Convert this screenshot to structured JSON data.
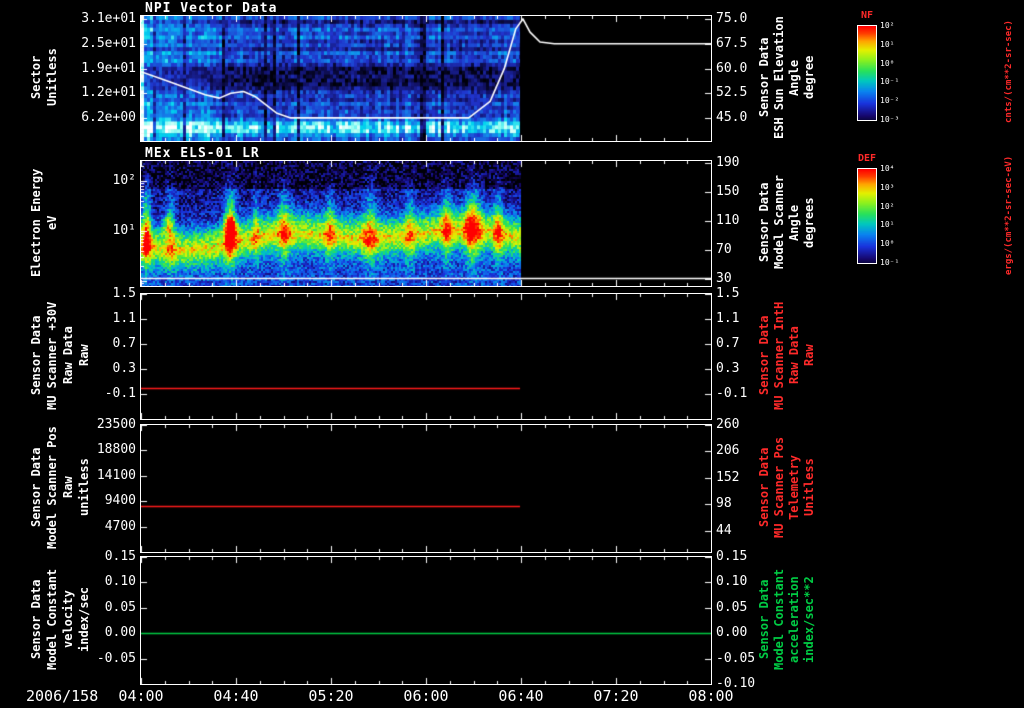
{
  "figure": {
    "date_label": "2006/158",
    "x_axis": {
      "tick_labels": [
        "04:00",
        "04:40",
        "05:20",
        "06:00",
        "06:40",
        "07:20",
        "08:00"
      ],
      "start_hour": 4.0,
      "end_hour": 8.0,
      "data_end_frac": 0.665
    }
  },
  "colors": {
    "background": "#000000",
    "axis": "#ffffff",
    "red": "#ff1a1a",
    "green": "#00cc44",
    "annotation_red": "#ff2a2a",
    "annotation_green": "#00cc44",
    "colorbar_title": "#ff2a2a"
  },
  "panels": [
    {
      "id": "npi",
      "title": "NPI Vector Data",
      "type": "spectrogram",
      "left_axis": {
        "label_lines": [
          "Sector",
          "Unitless"
        ],
        "ticks": [
          "3.1e+01",
          "2.5e+01",
          "1.9e+01",
          "1.2e+01",
          "6.2e+00"
        ],
        "tick_fracs": [
          0.024,
          0.222,
          0.42,
          0.618,
          0.816
        ],
        "color": "#ffffff"
      },
      "right_axis": {
        "label_lines": [
          "Sensor Data",
          "ESH Sun Elevation",
          "Angle",
          "degree"
        ],
        "ticks": [
          "75.0",
          "67.5",
          "60.0",
          "52.5",
          "45.0"
        ],
        "tick_fracs": [
          0.024,
          0.222,
          0.42,
          0.618,
          0.816
        ],
        "color": "#ffffff"
      },
      "overlay": {
        "name": "ESH Sun Elevation Angle",
        "color": "#ffffff",
        "value_top": 75.9,
        "value_bottom": 38.0,
        "points": [
          [
            4.0,
            59
          ],
          [
            4.2,
            56
          ],
          [
            4.45,
            52
          ],
          [
            4.55,
            51
          ],
          [
            4.63,
            52.5
          ],
          [
            4.72,
            53
          ],
          [
            4.8,
            51.5
          ],
          [
            4.95,
            46.5
          ],
          [
            5.05,
            45
          ],
          [
            6.3,
            45
          ],
          [
            6.45,
            50
          ],
          [
            6.55,
            60
          ],
          [
            6.63,
            72
          ],
          [
            6.68,
            75
          ],
          [
            6.73,
            71
          ],
          [
            6.8,
            68
          ],
          [
            6.9,
            67.5
          ],
          [
            8.0,
            67.5
          ]
        ]
      },
      "spectro": {
        "row_profile": [
          0.4,
          0.2,
          0.32,
          0.44,
          0.34,
          0.46,
          0.3,
          0.4,
          0.24,
          0.44,
          0.34,
          0.4,
          0.26,
          0.12,
          0.1,
          0.14,
          0.1,
          0.12,
          0.16,
          0.3,
          0.36,
          0.28,
          0.42,
          0.32,
          0.4,
          0.34,
          0.48,
          0.7,
          0.8,
          0.74,
          0.55,
          0.42
        ]
      }
    },
    {
      "id": "els",
      "title": "MEx ELS-01 LR",
      "type": "spectrogram",
      "left_axis": {
        "label_lines": [
          "Electron Energy",
          "eV"
        ],
        "ticks": [
          "10²",
          "10¹"
        ],
        "tick_fracs": [
          0.16,
          0.56
        ],
        "color": "#ffffff"
      },
      "right_axis": {
        "label_lines": [
          "Sensor Data",
          "Model Scanner",
          "Angle",
          "degrees"
        ],
        "ticks": [
          "190",
          "150",
          "110",
          "70",
          "30"
        ],
        "tick_fracs": [
          0.016,
          0.248,
          0.48,
          0.712,
          0.944
        ],
        "color": "#ffffff"
      },
      "overlay": {
        "name": "Model Scanner Angle",
        "color": "#ffffff",
        "constant_frac": 0.936,
        "full_width": true
      },
      "spectro": {
        "streaks": [
          {
            "f": 0.008,
            "a": 0.5,
            "w": 0.006
          },
          {
            "f": 0.05,
            "a": 0.25,
            "w": 0.006
          },
          {
            "f": 0.155,
            "a": 0.5,
            "w": 0.007
          },
          {
            "f": 0.2,
            "a": 0.2,
            "w": 0.005
          },
          {
            "f": 0.25,
            "a": 0.3,
            "w": 0.008
          },
          {
            "f": 0.33,
            "a": 0.25,
            "w": 0.006
          },
          {
            "f": 0.4,
            "a": 0.3,
            "w": 0.009
          },
          {
            "f": 0.47,
            "a": 0.25,
            "w": 0.006
          },
          {
            "f": 0.535,
            "a": 0.3,
            "w": 0.007
          },
          {
            "f": 0.58,
            "a": 0.45,
            "w": 0.01
          },
          {
            "f": 0.625,
            "a": 0.3,
            "w": 0.006
          }
        ],
        "hotspots": [
          {
            "f": 0.155,
            "y": 0.52,
            "a": 0.55
          },
          {
            "f": 0.045,
            "y": 0.5,
            "a": 0.3
          }
        ]
      }
    },
    {
      "id": "mu-30v",
      "title": "",
      "type": "line",
      "left_axis": {
        "label_lines": [
          "Sensor Data",
          "MU Scanner +30V",
          "Raw Data",
          "Raw"
        ],
        "ticks": [
          "1.5",
          "1.1",
          "0.7",
          "0.3",
          "-0.1"
        ],
        "tick_fracs": [
          0.0,
          0.2,
          0.4,
          0.6,
          0.8
        ],
        "value_top": 1.5,
        "value_bottom": -0.5,
        "color": "#ffffff"
      },
      "right_axis": {
        "label_lines": [
          "Sensor Data",
          "MU Scanner IntH",
          "Raw Data",
          "Raw"
        ],
        "ticks": [
          "1.5",
          "1.1",
          "0.7",
          "0.3",
          "-0.1"
        ],
        "tick_fracs": [
          0.0,
          0.2,
          0.4,
          0.6,
          0.8
        ],
        "color": "#ff2a2a"
      },
      "series": {
        "name": "MU Scanner +30V Raw Data",
        "color_key": "red",
        "constant_value": 0.0,
        "x_end_frac": 0.665
      }
    },
    {
      "id": "scanner-pos",
      "title": "",
      "type": "line",
      "left_axis": {
        "label_lines": [
          "Sensor Data",
          "Model Scanner Pos",
          "Raw",
          "unitless"
        ],
        "ticks": [
          "23500",
          "18800",
          "14100",
          "9400",
          "4700"
        ],
        "tick_fracs": [
          0.0,
          0.2,
          0.4,
          0.6,
          0.8
        ],
        "value_top": 23500,
        "value_bottom": 0,
        "color": "#ffffff"
      },
      "right_axis": {
        "label_lines": [
          "Sensor Data",
          "MU Scanner Pos",
          "Telemetry",
          "Unitless"
        ],
        "ticks": [
          "260",
          "206",
          "152",
          "98",
          "44"
        ],
        "tick_fracs": [
          0.0,
          0.208,
          0.415,
          0.623,
          0.831
        ],
        "color": "#ff2a2a"
      },
      "series": {
        "name": "Model Scanner Pos Raw",
        "color_key": "red",
        "constant_value": 8500,
        "x_end_frac": 0.665
      }
    },
    {
      "id": "model-constant",
      "title": "",
      "type": "line",
      "left_axis": {
        "label_lines": [
          "Sensor Data",
          "Model Constant",
          "velocity",
          "index/sec"
        ],
        "ticks": [
          "0.15",
          "0.10",
          "0.05",
          "0.00",
          "-0.05"
        ],
        "tick_fracs": [
          0.0,
          0.2,
          0.4,
          0.6,
          0.8
        ],
        "value_top": 0.15,
        "value_bottom": -0.1,
        "color": "#ffffff"
      },
      "right_axis": {
        "label_lines": [
          "Sensor Data",
          "Model Constant",
          "acceleration",
          "index/sec**2"
        ],
        "ticks": [
          "0.15",
          "0.10",
          "0.05",
          "0.00",
          "-0.05",
          "-0.10"
        ],
        "tick_fracs": [
          0.0,
          0.2,
          0.4,
          0.6,
          0.8,
          1.0
        ],
        "color": "#00cc44"
      },
      "series": {
        "name": "Model Constant velocity",
        "color_key": "green",
        "constant_value": 0.0,
        "x_end_frac": 1.0
      }
    }
  ],
  "colorbars": [
    {
      "title": "NF",
      "ticks": [
        "10²",
        "10¹",
        "10⁰",
        "10⁻¹",
        "10⁻²",
        "10⁻³"
      ],
      "unit": "cnts/(cm**2-sr-sec)"
    },
    {
      "title": "DEF",
      "ticks": [
        "10⁴",
        "10³",
        "10²",
        "10¹",
        "10⁰",
        "10⁻¹"
      ],
      "unit": "ergs/(cm**2-sr-sec-eV)"
    }
  ],
  "chart_data": [
    {
      "type": "heatmap",
      "title": "NPI Vector Data",
      "x_range": [
        "2006/158 04:00",
        "2006/158 08:00"
      ],
      "data_coverage": [
        "04:00",
        "06:40"
      ],
      "ylabel": "Sector Unitless",
      "yticks": [
        31,
        25,
        19,
        12,
        6.2
      ],
      "colorbar_title": "NF",
      "colorbar_unit": "cnts/(cm**2-sr-sec)",
      "description": "Blue/cyan sector-vs-time spectrogram; bright cyan band at lowest sectors, dark mid-sector band, enhanced counts before ~04:40; no data after 06:40",
      "overlay": {
        "name": "ESH Sun Elevation Angle (degree)",
        "ylim": [
          45,
          75
        ],
        "points_hour_deg": [
          [
            4.0,
            59
          ],
          [
            4.45,
            52
          ],
          [
            4.72,
            53
          ],
          [
            5.05,
            45
          ],
          [
            6.3,
            45
          ],
          [
            6.68,
            75
          ],
          [
            6.9,
            67.5
          ],
          [
            8.0,
            67.5
          ]
        ]
      }
    },
    {
      "type": "heatmap",
      "title": "MEx ELS-01 LR",
      "x_range": [
        "04:00",
        "08:00"
      ],
      "data_coverage": [
        "04:00",
        "06:40"
      ],
      "ylabel": "Electron Energy (eV)",
      "yscale": "log",
      "yticks": [
        100,
        10
      ],
      "colorbar_title": "DEF",
      "colorbar_unit": "ergs/(cm**2-sr-sec-eV)",
      "description": "Electron energy spectrogram; intense yellow-green band near 10-30 eV with intermittent vertical flux enhancements and a red hotspot near 04:37; no data after 06:40",
      "overlay": {
        "name": "Model Scanner Angle (degrees)",
        "constant": 30,
        "ylim": [
          30,
          190
        ]
      }
    },
    {
      "type": "line",
      "ylabel": "Sensor Data MU Scanner +30V Raw Data Raw",
      "ylim": [
        -0.5,
        1.5
      ],
      "series": [
        {
          "name": "MU Scanner IntH Raw Data Raw",
          "color": "red",
          "value": 0.0,
          "x_coverage": [
            "04:00",
            "06:40"
          ]
        }
      ]
    },
    {
      "type": "line",
      "ylabel": "Sensor Data Model Scanner Pos Raw unitless",
      "ylim": [
        0,
        23500
      ],
      "series": [
        {
          "name": "MU Scanner Pos Telemetry Unitless",
          "color": "red",
          "value": 8500,
          "x_coverage": [
            "04:00",
            "06:40"
          ]
        }
      ]
    },
    {
      "type": "line",
      "ylabel": "Sensor Data Model Constant velocity index/sec",
      "ylim": [
        -0.1,
        0.15
      ],
      "series": [
        {
          "name": "Model Constant acceleration index/sec**2",
          "color": "green",
          "value": 0.0,
          "x_coverage": [
            "04:00",
            "08:00"
          ]
        }
      ]
    }
  ]
}
